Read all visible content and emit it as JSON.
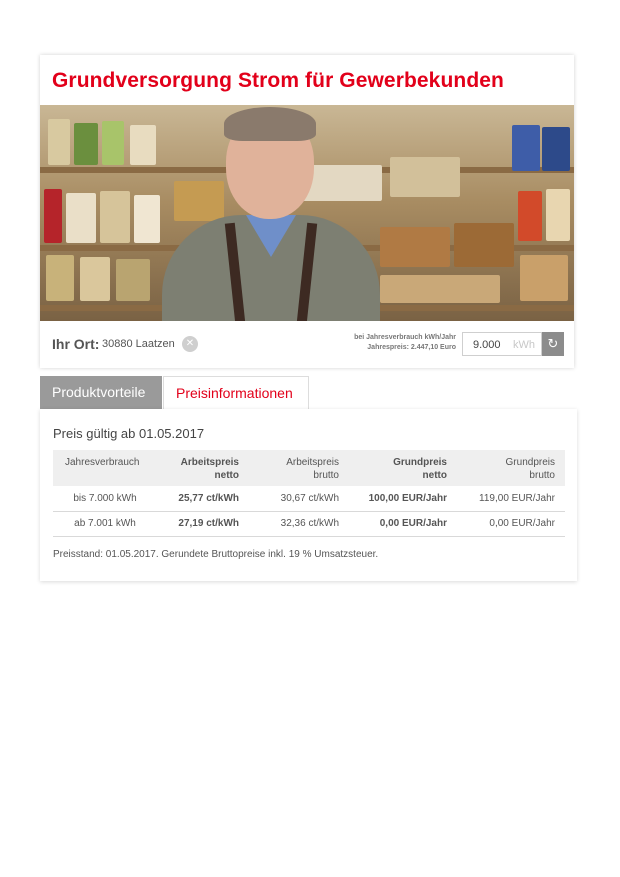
{
  "header": {
    "title": "Grundversorgung Strom für Gewerbekunden"
  },
  "location": {
    "label": "Ihr Ort:",
    "value": "30880 Laatzen",
    "clear_icon": "close-icon"
  },
  "usage": {
    "note_line1": "bei Jahresverbrauch kWh/Jahr",
    "note_line2": "Jahrespreis: 2.447,10 Euro",
    "value": "9.000",
    "unit": "kWh",
    "refresh_icon": "refresh-icon"
  },
  "tabs": [
    {
      "label": "Produktvorteile",
      "active": false
    },
    {
      "label": "Preisinformationen",
      "active": true
    }
  ],
  "prices": {
    "valid_from": "Preis gültig ab 01.05.2017",
    "columns": [
      {
        "line1": "Jahresverbrauch",
        "line2": ""
      },
      {
        "line1": "Arbeitspreis",
        "line2": "netto"
      },
      {
        "line1": "Arbeitspreis",
        "line2": "brutto"
      },
      {
        "line1": "Grundpreis",
        "line2": "netto"
      },
      {
        "line1": "Grundpreis",
        "line2": "brutto"
      }
    ],
    "rows": [
      [
        "bis 7.000 kWh",
        "25,77 ct/kWh",
        "30,67 ct/kWh",
        "100,00 EUR/Jahr",
        "119,00 EUR/Jahr"
      ],
      [
        "ab 7.001 kWh",
        "27,19 ct/kWh",
        "32,36 ct/kWh",
        "0,00 EUR/Jahr",
        "0,00 EUR/Jahr"
      ]
    ],
    "footnote": "Preisstand: 01.05.2017. Gerundete Bruttopreise inkl. 19 % Umsatzsteuer."
  },
  "colors": {
    "brand_red": "#e2001a",
    "tab_inactive": "#9a9a9a"
  }
}
